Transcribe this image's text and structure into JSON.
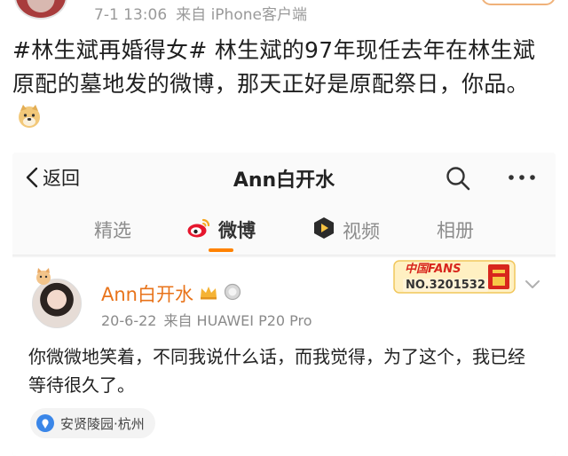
{
  "top_post": {
    "time": "7-1 13:06",
    "source": "来自 iPhone客户端",
    "text": "#林生斌再婚得女# 林生斌的97年现任去年在林生斌原配的墓地发的微博，那天正好是原配祭日，你品。"
  },
  "embedded": {
    "nav": {
      "back_label": "返回",
      "title": "Ann白开水"
    },
    "tabs": [
      {
        "label": "精选"
      },
      {
        "label": "微博"
      },
      {
        "label": "视频"
      },
      {
        "label": "相册"
      }
    ],
    "active_tab": "微博",
    "post": {
      "username": "Ann白开水",
      "date": "20-6-22",
      "device": "来自 HUAWEI P20 Pro",
      "fans_badge_label": "中国FANS",
      "fans_number": "NO.3201532",
      "text": "你微微地笑着，不同我说什么话，而我觉得，为了这个，我已经等待很久了。",
      "location": "安贤陵园·杭州"
    }
  },
  "colors": {
    "username": "#e8731a",
    "tab_underline": "#ff8200",
    "meta_gray": "#9a9a9a",
    "fans_red": "#d8261d"
  }
}
